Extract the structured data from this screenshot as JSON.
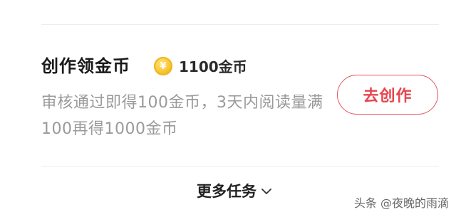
{
  "task": {
    "title": "创作领金币",
    "coin_icon": "coin-icon",
    "coin_symbol": "¥",
    "reward": "1100金币",
    "description": "审核通过即得100金币，3天内阅读量满100再得1000金币",
    "action_label": "去创作"
  },
  "footer": {
    "more_label": "更多任务",
    "chevron_icon": "chevron-down-icon"
  },
  "watermark": "头条 @夜晚的雨滴",
  "colors": {
    "accent": "#e6464e",
    "text_primary": "#1a1a1a",
    "text_secondary": "#9a9a9a",
    "coin": "#f7c531",
    "divider": "#ededed"
  }
}
